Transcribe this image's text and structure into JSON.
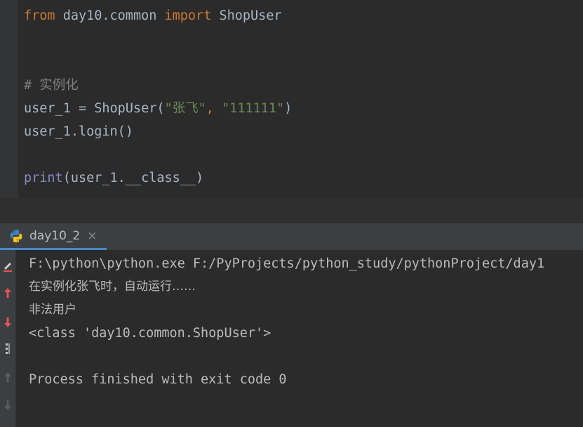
{
  "editor": {
    "lines": [
      {
        "tokens": [
          {
            "t": "from ",
            "c": "kw"
          },
          {
            "t": "day10.common ",
            "c": ""
          },
          {
            "t": "import ",
            "c": "kw"
          },
          {
            "t": "ShopUser",
            "c": ""
          }
        ]
      },
      {
        "tokens": []
      },
      {
        "tokens": []
      },
      {
        "tokens": [
          {
            "t": "# 实例化",
            "c": "cmt"
          }
        ]
      },
      {
        "tokens": [
          {
            "t": "user_1 = ShopUser(",
            "c": ""
          },
          {
            "t": "\"张飞\"",
            "c": "str"
          },
          {
            "t": ", ",
            "c": "kw"
          },
          {
            "t": "\"111111\"",
            "c": "str"
          },
          {
            "t": ")",
            "c": ""
          }
        ]
      },
      {
        "tokens": [
          {
            "t": "user_1.login()",
            "c": ""
          }
        ]
      },
      {
        "tokens": []
      },
      {
        "tokens": [
          {
            "t": "print",
            "c": "bi"
          },
          {
            "t": "(user_1.__class__)",
            "c": ""
          }
        ]
      }
    ]
  },
  "run": {
    "tab_label": "day10_2",
    "close_glyph": "×",
    "python_icon": "python-icon",
    "accent": "#4a88c7"
  },
  "console": {
    "lines": [
      "F:\\python\\python.exe F:/PyProjects/python_study/pythonProject/day1",
      "在实例化张飞时，自动运行……",
      "非法用户",
      "<class 'day10.common.ShopUser'>",
      "",
      "Process finished with exit code 0"
    ]
  },
  "toolbar": {
    "icons": [
      "edit-icon",
      "up-arrow-icon",
      "down-arrow-icon",
      "more-icon",
      "up-arrow-disabled-icon",
      "down-arrow-disabled-icon"
    ]
  }
}
